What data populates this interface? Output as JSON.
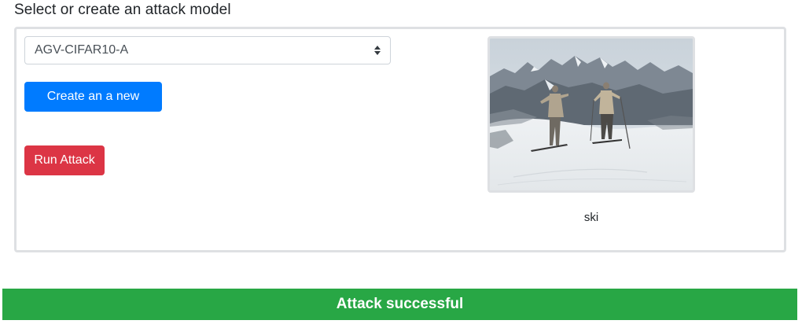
{
  "section": {
    "title": "Select or create an attack model"
  },
  "model_select": {
    "selected": "AGV-CIFAR10-A",
    "icon": "sort-arrows-icon"
  },
  "buttons": {
    "create_filter": "Create an a new filter",
    "run_attack": "Run Attack"
  },
  "image": {
    "caption": "ski",
    "description_icon": "skiers-photo"
  },
  "status": {
    "text": "Attack successful",
    "color": "#28a745"
  },
  "colors": {
    "primary": "#007bff",
    "danger": "#dc3545",
    "success": "#28a745"
  }
}
